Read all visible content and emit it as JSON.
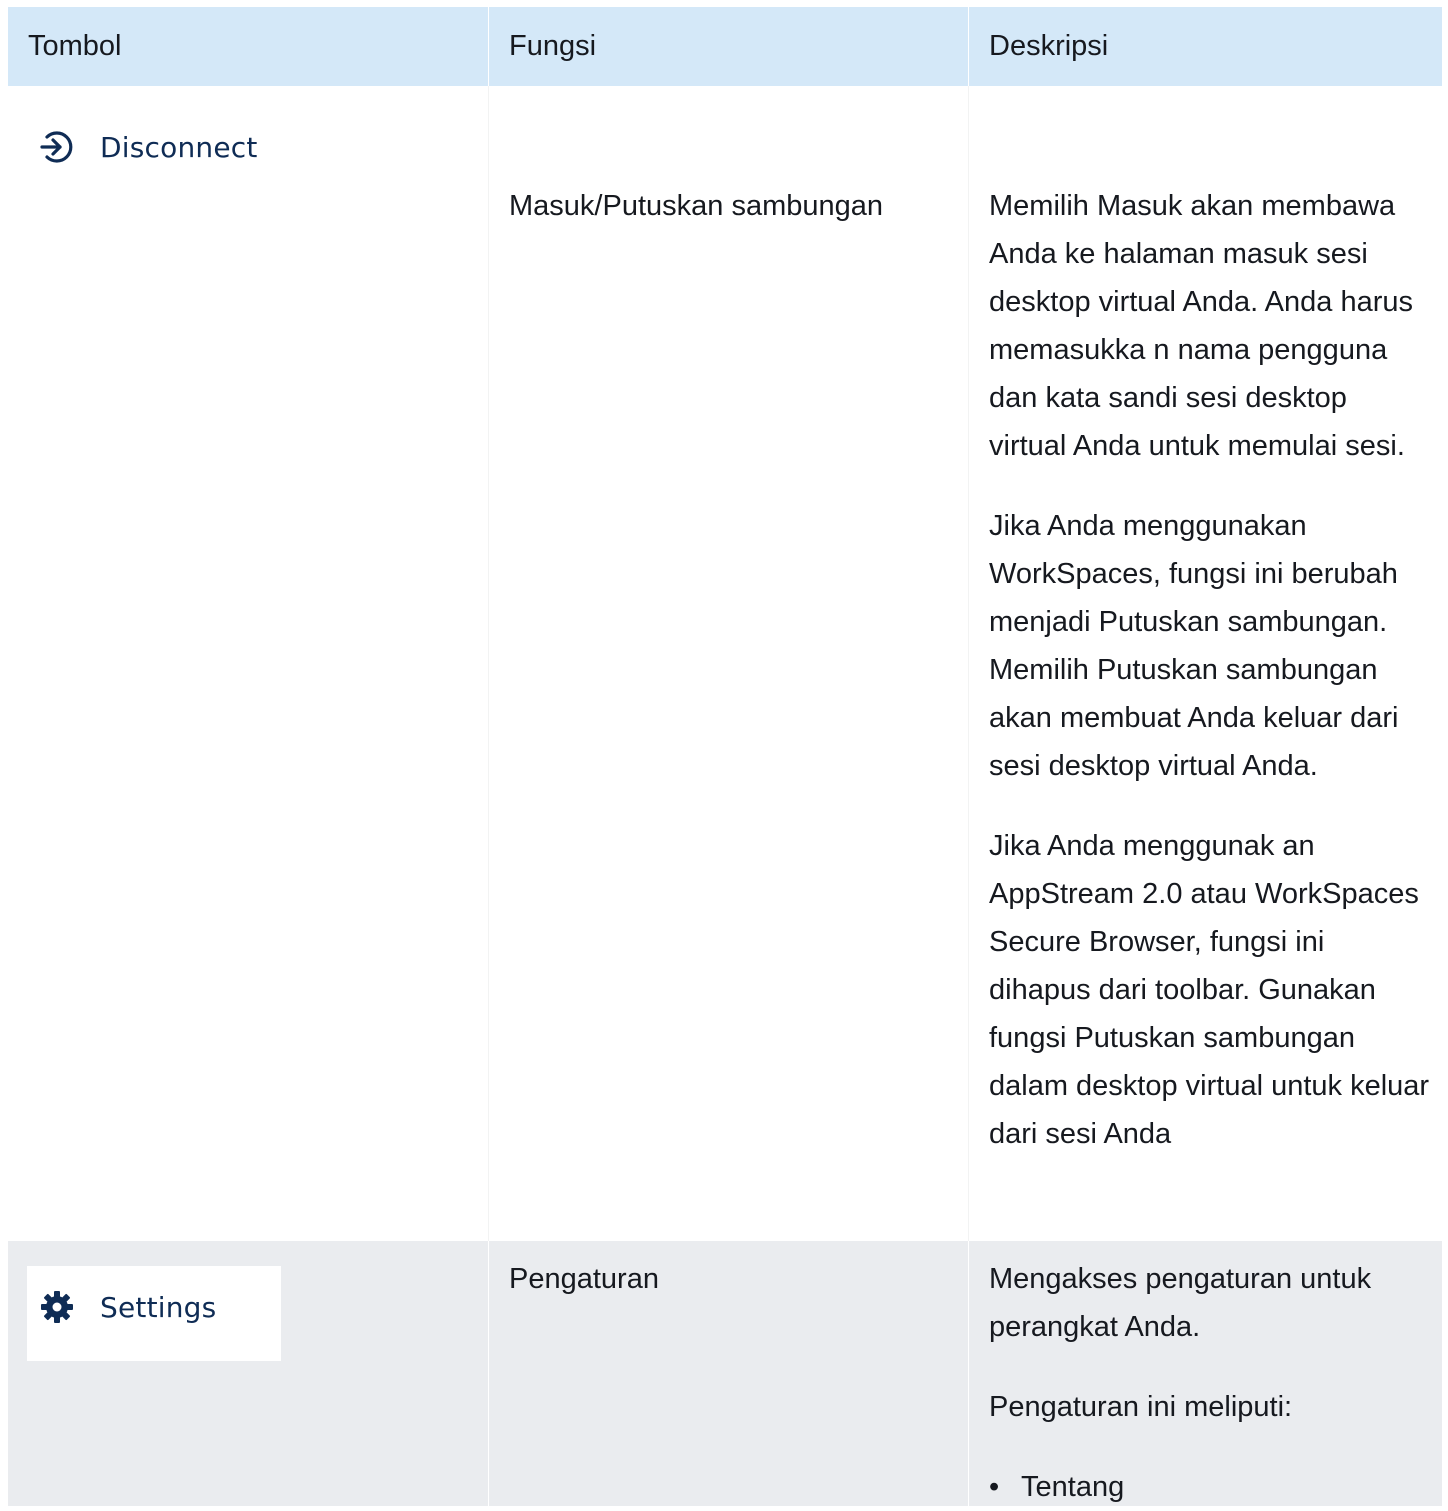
{
  "table": {
    "headers": [
      "Tombol",
      "Fungsi",
      "Deskripsi"
    ],
    "rows": [
      {
        "button": {
          "label": "Disconnect",
          "icon": "sign-in-arrow-icon"
        },
        "function": "Masuk/Putuskan sambungan",
        "description": [
          "Memilih Masuk akan membawa Anda ke halaman masuk sesi desktop virtual Anda. Anda harus memasukka n nama pengguna dan kata sandi sesi desktop virtual Anda untuk memulai sesi.",
          "Jika Anda menggunakan WorkSpaces, fungsi ini berubah menjadi Putuskan sambungan. Memilih Putuskan sambungan akan membuat Anda keluar dari sesi desktop virtual Anda.",
          "Jika Anda menggunak an AppStream 2.0 atau WorkSpaces Secure Browser, fungsi ini dihapus dari toolbar. Gunakan fungsi Putuskan sambungan dalam desktop virtual untuk keluar dari sesi Anda"
        ]
      },
      {
        "button": {
          "label": "Settings",
          "icon": "gear-icon"
        },
        "function": "Pengaturan",
        "description": [
          "Mengakses pengaturan untuk perangkat Anda.",
          "Pengaturan ini meliputi:"
        ],
        "list": [
          "Tentang"
        ]
      }
    ]
  }
}
